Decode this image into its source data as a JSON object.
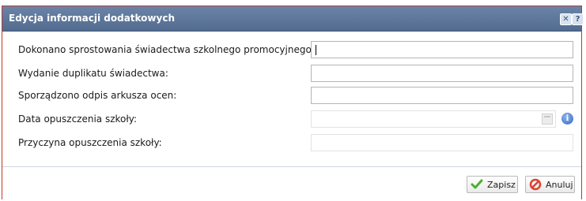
{
  "dialog": {
    "title": "Edycja informacji dodatkowych",
    "close_symbol": "✕",
    "help_symbol": "?"
  },
  "form": {
    "fields": [
      {
        "label": "Dokonano sprostowania świadectwa szkolnego promocyjnego:",
        "value": "",
        "state": "focused"
      },
      {
        "label": "Wydanie duplikatu świadectwa:",
        "value": "",
        "state": "enabled"
      },
      {
        "label": "Sporządzono odpis arkusza ocen:",
        "value": "",
        "state": "enabled"
      },
      {
        "label": "Data opuszczenia szkoły:",
        "value": "",
        "state": "disabled",
        "icons": [
          "calendar-icon",
          "info-icon"
        ]
      },
      {
        "label": "Przyczyna opuszczenia szkoły:",
        "value": "",
        "state": "disabled"
      }
    ]
  },
  "footer": {
    "save_label": "Zapisz",
    "cancel_label": "Anuluj"
  },
  "colors": {
    "titlebar": "#5d7599",
    "dialog_border": "#c0392b",
    "save_check": "#4caf2f",
    "cancel_icon": "#d9432f",
    "info_icon": "#2f68c4"
  }
}
